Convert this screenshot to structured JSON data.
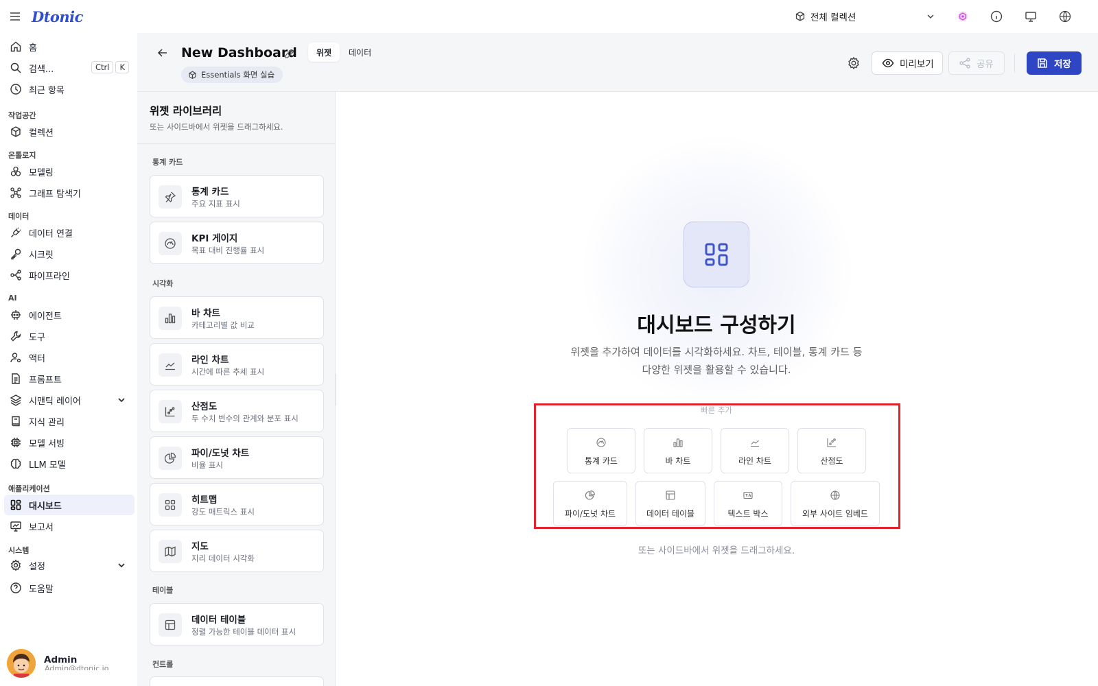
{
  "app": {
    "logo": "Dtonic",
    "collection": "전체 컬렉션"
  },
  "sidebar": {
    "home": "홈",
    "search": "검색...",
    "search_kbd_1": "Ctrl",
    "search_kbd_2": "K",
    "recent": "최근 항목",
    "sec_workspace": "작업공간",
    "collections": "컬렉션",
    "sec_ontology": "온톨로지",
    "modeling": "모델링",
    "graph_explorer": "그래프 탐색기",
    "sec_data": "데이터",
    "data_connection": "데이터 연결",
    "secrets": "시크릿",
    "pipeline": "파이프라인",
    "sec_ai": "AI",
    "agent": "에이전트",
    "tools": "도구",
    "actor": "액터",
    "prompt": "프롬프트",
    "semantic_layer": "시맨틱 레이어",
    "knowledge": "지식 관리",
    "model_serving": "모델 서빙",
    "llm_model": "LLM 모델",
    "sec_apps": "애플리케이션",
    "dashboard": "대시보드",
    "report": "보고서",
    "sec_system": "시스템",
    "settings": "설정",
    "help": "도움말",
    "user_name": "Admin",
    "user_email": "Admin@dtonic.io"
  },
  "header": {
    "title": "New Dashboard",
    "tab_widget": "위젯",
    "tab_data": "데이터",
    "chip": "Essentials 화면 실습",
    "preview": "미리보기",
    "share": "공유",
    "save": "저장"
  },
  "library": {
    "title": "위젯 라이브러리",
    "subtitle": "또는 사이드바에서 위젯을 드래그하세요.",
    "sec_stats": "통계 카드",
    "sec_viz": "시각화",
    "sec_table": "테이블",
    "sec_control": "컨트롤",
    "items": [
      {
        "name": "통계 카드",
        "desc": "주요 지표 표시"
      },
      {
        "name": "KPI 게이지",
        "desc": "목표 대비 진행률 표시"
      },
      {
        "name": "바 차트",
        "desc": "카테고리별 값 비교"
      },
      {
        "name": "라인 차트",
        "desc": "시간에 따른 추세 표시"
      },
      {
        "name": "산점도",
        "desc": "두 수치 변수의 관계와 분포 표시"
      },
      {
        "name": "파이/도넛 차트",
        "desc": "비율 표시"
      },
      {
        "name": "히트맵",
        "desc": "강도 매트릭스 표시"
      },
      {
        "name": "지도",
        "desc": "지리 데이터 시각화"
      },
      {
        "name": "데이터 테이블",
        "desc": "정렬 가능한 테이블 데이터 표시"
      }
    ]
  },
  "canvas": {
    "title": "대시보드 구성하기",
    "desc_line1": "위젯을 추가하여 데이터를 시각화하세요. 차트, 테이블, 통계 카드 등",
    "desc_line2": "다양한 위젯을 활용할 수 있습니다.",
    "quick_label": "빠른 추가",
    "quick": [
      "통계 카드",
      "바 차트",
      "라인 차트",
      "산점도",
      "파이/도넛 차트",
      "데이터 테이블",
      "텍스트 박스",
      "외부 사이트 임베드"
    ],
    "hint": "또는 사이드바에서 위젯을 드래그하세요."
  },
  "colors": {
    "accent": "#2e46c3",
    "highlight": "#e0242a",
    "active_nav": "#eef0fb"
  }
}
